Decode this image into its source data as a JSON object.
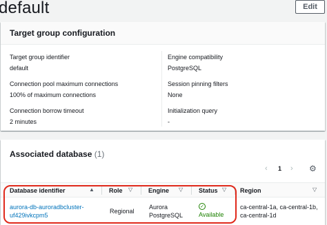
{
  "header": {
    "title": "default",
    "edit_label": "Edit"
  },
  "config": {
    "title": "Target group configuration",
    "fields": [
      {
        "key": "Target group identifier",
        "value": "default"
      },
      {
        "key": "Engine compatibility",
        "value": "PostgreSQL"
      },
      {
        "key": "Connection pool maximum connections",
        "value": "100% of maximum connections"
      },
      {
        "key": "Session pinning filters",
        "value": "None"
      },
      {
        "key": "Connection borrow timeout",
        "value": "2 minutes"
      },
      {
        "key": "Initialization query",
        "value": "-"
      }
    ]
  },
  "associated": {
    "title": "Associated database",
    "count": "(1)",
    "pager": {
      "page": "1",
      "prev": "‹",
      "next": "›"
    },
    "columns": [
      "Database identifier",
      "Role",
      "Engine",
      "Status",
      "Region"
    ],
    "rows": [
      {
        "identifier_line1": "aurora-db-auroradbcluster-",
        "identifier_line2": "uf429ivkcpm5",
        "role": "Regional",
        "engine_line1": "Aurora",
        "engine_line2": "PostgreSQL",
        "status": "Available",
        "region_line1": "ca-central-1a, ca-central-1b,",
        "region_line2": "ca-central-1d"
      }
    ]
  },
  "icons": {
    "sort_asc": "▲",
    "sort_none": "▽",
    "gear": "⚙",
    "status_ok": "✓"
  },
  "colors": {
    "link": "#0073bb",
    "success": "#1d8102",
    "highlight": "#e0281a"
  }
}
